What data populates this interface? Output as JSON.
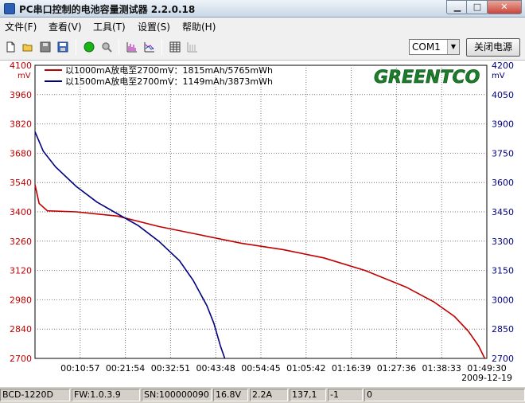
{
  "window": {
    "title": "PC串口控制的电池容量测试器 2.2.0.18"
  },
  "menu": [
    {
      "label": "文件(F)"
    },
    {
      "label": "查看(V)"
    },
    {
      "label": "工具(T)"
    },
    {
      "label": "设置(S)"
    },
    {
      "label": "帮助(H)"
    }
  ],
  "toolbar": {
    "port_value": "COM1",
    "power_button": "关闭电源",
    "icons": [
      "new-file-icon",
      "open-folder-icon",
      "disk-icon",
      "save-icon",
      "start-green-icon",
      "search-icon",
      "chart-bars-icon",
      "chart-line-icon",
      "table-icon",
      "grid-icon"
    ]
  },
  "chart": {
    "logo": "GREENTCO",
    "left_unit": "mV",
    "right_unit": "mV",
    "date": "2009-12-19",
    "colors": {
      "series1": "#c00000",
      "series2": "#000080",
      "grid": "#777777"
    }
  },
  "chart_data": {
    "type": "line",
    "xlabel": "",
    "ylabel": "mV",
    "x_ticks": [
      "00:10:57",
      "00:21:54",
      "00:32:51",
      "00:43:48",
      "00:54:45",
      "01:05:42",
      "01:16:39",
      "01:27:36",
      "01:38:33",
      "01:49:30"
    ],
    "x_range_seconds": [
      0,
      6570
    ],
    "left_axis": {
      "ticks": [
        4100,
        3960,
        3820,
        3680,
        3540,
        3400,
        3260,
        3120,
        2980,
        2840,
        2700
      ],
      "ylim": [
        2700,
        4100
      ]
    },
    "right_axis": {
      "ticks": [
        4200,
        4050,
        3900,
        3750,
        3600,
        3450,
        3300,
        3150,
        3000,
        2850,
        2700
      ],
      "ylim": [
        2700,
        4200
      ]
    },
    "grid": true,
    "legend_position": "top-left",
    "series": [
      {
        "name": "以1000mA放电至2700mV：1815mAh/5765mWh",
        "axis": "left",
        "x": [
          0,
          60,
          180,
          600,
          1200,
          1800,
          2400,
          3000,
          3600,
          4200,
          4800,
          5400,
          5800,
          6100,
          6300,
          6450,
          6540
        ],
        "y": [
          3530,
          3440,
          3405,
          3400,
          3380,
          3330,
          3290,
          3250,
          3220,
          3180,
          3120,
          3040,
          2970,
          2900,
          2830,
          2760,
          2700
        ]
      },
      {
        "name": "以1500mA放电至2700mV：1149mAh/3873mWh",
        "axis": "right",
        "x": [
          0,
          120,
          300,
          600,
          900,
          1200,
          1500,
          1800,
          2100,
          2300,
          2500,
          2600,
          2700,
          2760
        ],
        "y": [
          3860,
          3760,
          3680,
          3580,
          3500,
          3440,
          3380,
          3300,
          3200,
          3100,
          2970,
          2880,
          2760,
          2700
        ]
      }
    ]
  },
  "status": [
    "BCD-1220D",
    "FW:1.0.3.9",
    "SN:100000090",
    "16.8V",
    "2.2A",
    "137,1",
    "-1",
    "0"
  ]
}
